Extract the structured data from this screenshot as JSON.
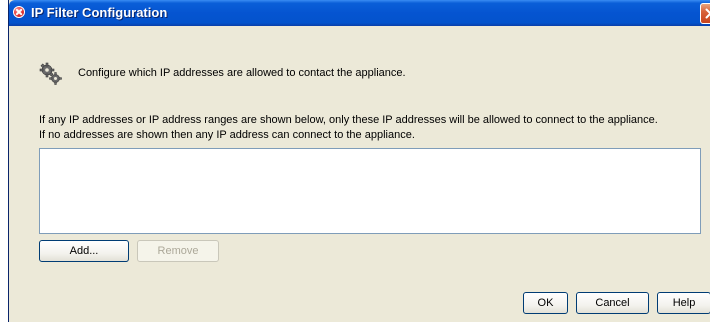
{
  "window": {
    "title": "IP Filter Configuration"
  },
  "header": {
    "description": "Configure which IP addresses are allowed to contact the appliance."
  },
  "info": {
    "line1": "If any IP addresses or IP address ranges are shown below, only these IP addresses will be allowed to connect to the appliance.",
    "line2": "If no addresses are shown then any IP address can connect to the appliance."
  },
  "address_list": {
    "items": []
  },
  "buttons": {
    "add": "Add...",
    "remove": "Remove",
    "ok": "OK",
    "cancel": "Cancel",
    "help": "Help"
  },
  "icons": {
    "title": "app-icon",
    "close": "close-icon",
    "header": "gears-icon"
  },
  "colors": {
    "titlebar": "#0554d1",
    "window_bg": "#ece9d8",
    "close": "#d8623a"
  }
}
